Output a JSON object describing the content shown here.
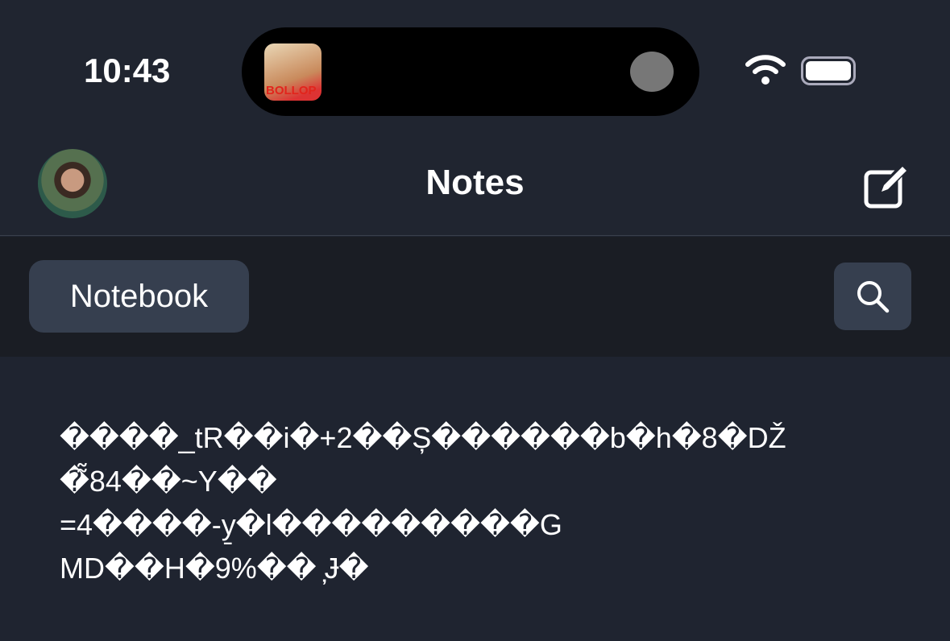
{
  "status": {
    "time": "10:43",
    "now_playing_art_text": "BOLLOP"
  },
  "nav": {
    "title": "Notes"
  },
  "toolbar": {
    "notebook_label": "Notebook"
  },
  "note": {
    "lines": [
      "����_tR��i�+2��Ș������b�h�8�DŽ",
      "�̃̃84��~Y��",
      "=4����-y̱�l���������G",
      "MD��H�9%�� ̦Ɉ�"
    ]
  }
}
